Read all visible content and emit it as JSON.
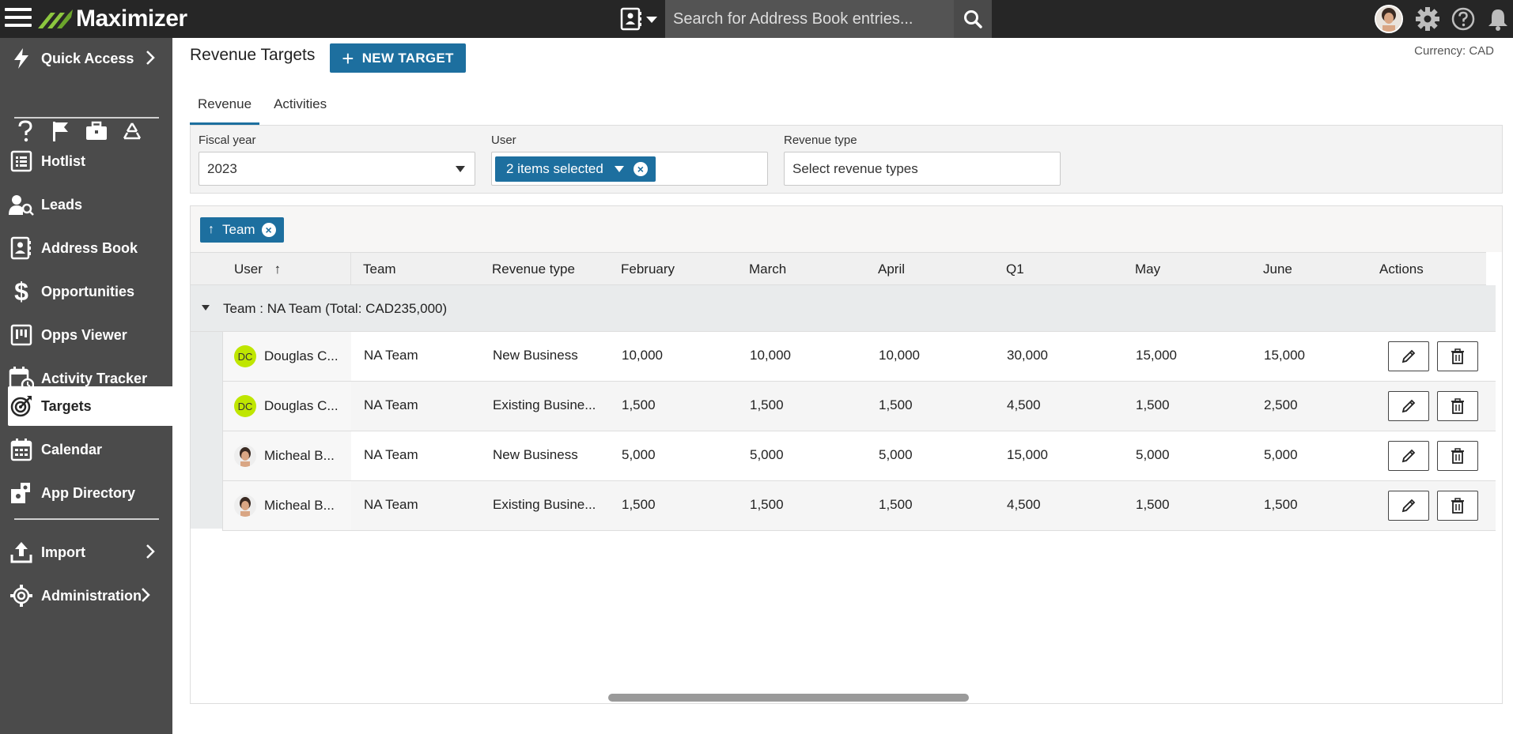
{
  "app": {
    "name": "Maximizer",
    "search_placeholder": "Search for Address Book entries..."
  },
  "sidebar": {
    "quick_access": "Quick Access",
    "items": [
      {
        "label": "Hotlist"
      },
      {
        "label": "Leads"
      },
      {
        "label": "Address Book"
      },
      {
        "label": "Opportunities"
      },
      {
        "label": "Opps Viewer"
      },
      {
        "label": "Activity Tracker"
      },
      {
        "label": "Targets"
      },
      {
        "label": "Calendar"
      },
      {
        "label": "App Directory"
      }
    ],
    "import": "Import",
    "administration": "Administration"
  },
  "main": {
    "title": "Revenue Targets",
    "new_target": "NEW TARGET",
    "currency": "Currency: CAD",
    "tabs": [
      {
        "label": "Revenue"
      },
      {
        "label": "Activities"
      }
    ],
    "filters": {
      "fiscal_year_label": "Fiscal year",
      "fiscal_year_value": "2023",
      "user_label": "User",
      "user_value": "2 items selected",
      "revenue_type_label": "Revenue type",
      "revenue_type_placeholder": "Select revenue types"
    },
    "group_chip": "Team",
    "columns": [
      "User",
      "Team",
      "Revenue type",
      "February",
      "March",
      "April",
      "Q1",
      "May",
      "June",
      "Actions"
    ],
    "group_row": "Team : NA Team (Total: CAD235,000)",
    "rows": [
      {
        "initials": "DC",
        "user": "Douglas C...",
        "team": "NA Team",
        "revenue_type": "New Business",
        "feb": "10,000",
        "mar": "10,000",
        "apr": "10,000",
        "q1": "30,000",
        "may": "15,000",
        "jun": "15,000"
      },
      {
        "initials": "DC",
        "user": "Douglas C...",
        "team": "NA Team",
        "revenue_type": "Existing Busine...",
        "feb": "1,500",
        "mar": "1,500",
        "apr": "1,500",
        "q1": "4,500",
        "may": "1,500",
        "jun": "2,500"
      },
      {
        "initials": "",
        "user": "Micheal B...",
        "team": "NA Team",
        "revenue_type": "New Business",
        "feb": "5,000",
        "mar": "5,000",
        "apr": "5,000",
        "q1": "15,000",
        "may": "5,000",
        "jun": "5,000"
      },
      {
        "initials": "",
        "user": "Micheal B...",
        "team": "NA Team",
        "revenue_type": "Existing Busine...",
        "feb": "1,500",
        "mar": "1,500",
        "apr": "1,500",
        "q1": "4,500",
        "may": "1,500",
        "jun": "1,500"
      }
    ]
  },
  "colors": {
    "topbar": "#262626",
    "sidebar": "#4b4b4b",
    "accent": "#1d6f9f",
    "logo_green": "#8cc63f",
    "avatar_dc": "#bfe600"
  },
  "icons": {
    "top": [
      "menu-icon",
      "address-book-dropdown-icon",
      "search-icon",
      "user-avatar",
      "gear-icon",
      "help-icon",
      "bell-icon"
    ],
    "sidebar": [
      "lightning-icon",
      "question-icon",
      "flag-icon",
      "briefcase-icon",
      "recycle-icon",
      "list-icon",
      "lead-search-icon",
      "contact-card-icon",
      "dollar-icon",
      "kanban-icon",
      "calendar-clock-icon",
      "target-icon",
      "calendar-icon",
      "puzzle-icon",
      "upload-icon",
      "gear-icon"
    ],
    "grid": [
      "sort-up-icon",
      "pencil-icon",
      "trash-icon",
      "collapse-triangle-icon"
    ]
  }
}
